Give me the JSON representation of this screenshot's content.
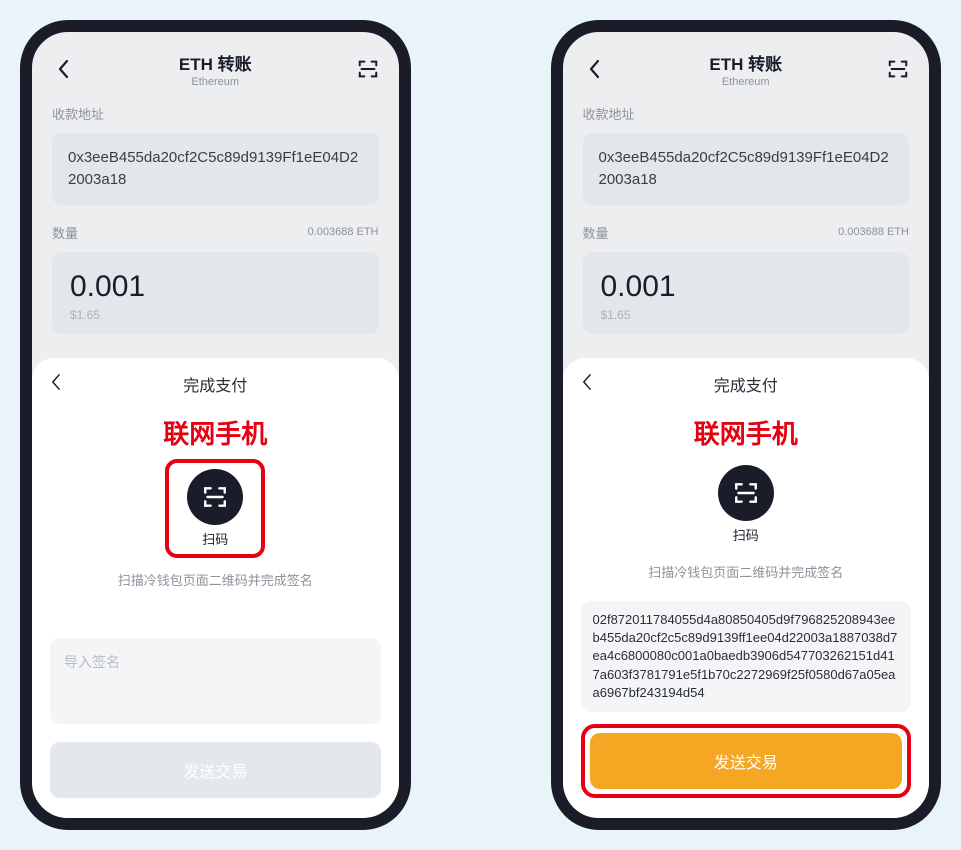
{
  "left": {
    "header": {
      "title": "ETH 转账",
      "subtitle": "Ethereum"
    },
    "recipient_label": "收款地址",
    "recipient_address": "0x3eeB455da20cf2C5c89d9139Ff1eE04D22003a18",
    "amount_label": "数量",
    "balance": "0.003688 ETH",
    "amount_value": "0.001",
    "amount_usd": "$1.65",
    "sheet": {
      "title": "完成支付",
      "annotation": "联网手机",
      "scan_label": "扫码",
      "instruction": "扫描冷钱包页面二维码并完成签名",
      "signature_placeholder": "导入签名",
      "send_button": "发送交易"
    }
  },
  "right": {
    "header": {
      "title": "ETH 转账",
      "subtitle": "Ethereum"
    },
    "recipient_label": "收款地址",
    "recipient_address": "0x3eeB455da20cf2C5c89d9139Ff1eE04D22003a18",
    "amount_label": "数量",
    "balance": "0.003688 ETH",
    "amount_value": "0.001",
    "amount_usd": "$1.65",
    "sheet": {
      "title": "完成支付",
      "annotation": "联网手机",
      "scan_label": "扫码",
      "instruction": "扫描冷钱包页面二维码并完成签名",
      "signature_value": "02f872011784055d4a80850405d9f796825208943eeb455da20cf2c5c89d9139ff1ee04d22003a1887038d7ea4c6800080c001a0baedb3906d547703262151d417a603f3781791e5f1b70c2272969f25f0580d67a05eaa6967bf243194d54",
      "send_button": "发送交易"
    }
  }
}
